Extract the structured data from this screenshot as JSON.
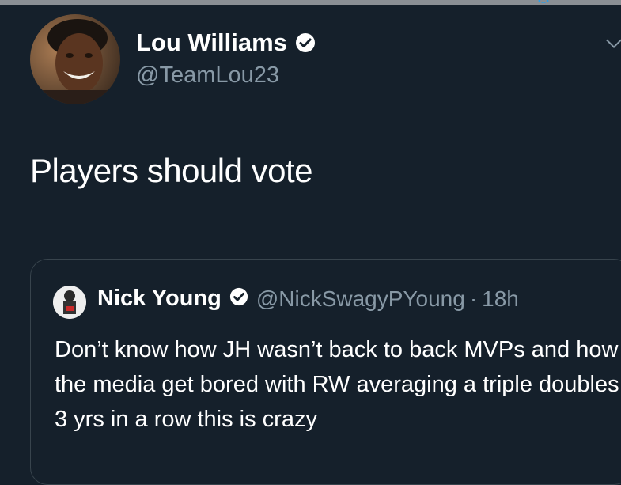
{
  "tweet": {
    "author_name": "Lou Williams",
    "author_handle": "@TeamLou23",
    "text": "Players should vote"
  },
  "quoted_tweet": {
    "author_name": "Nick Young",
    "author_handle": "@NickSwagyPYoung",
    "separator": "·",
    "time": "18h",
    "text": "Don’t know how JH wasn’t back to back MVPs and how the media get bored with RW averaging a triple doubles 3 yrs in a row this is crazy"
  },
  "colors": {
    "background": "#15202b",
    "secondary_text": "#8899a6",
    "border": "#38444d",
    "accent": "#1da1f2"
  },
  "icons": [
    "verified-badge-icon",
    "chevron-down-icon"
  ]
}
